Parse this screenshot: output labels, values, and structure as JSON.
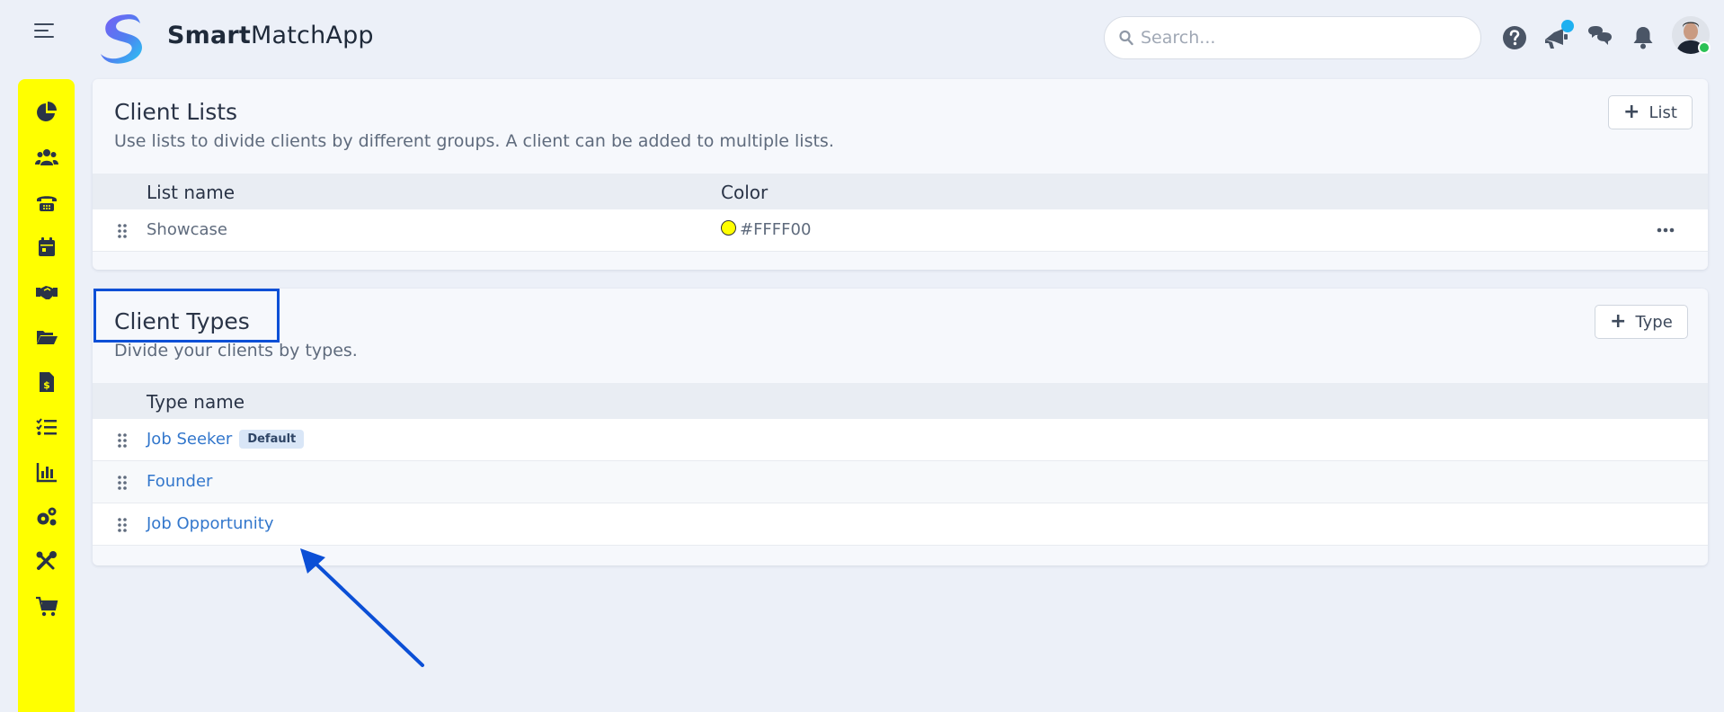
{
  "app": {
    "brand_bold": "Smart",
    "brand_rest": "MatchApp"
  },
  "search": {
    "placeholder": "Search..."
  },
  "header_icons": [
    "help-icon",
    "announcement-icon",
    "chat-icon",
    "notification-bell-icon",
    "user-avatar"
  ],
  "sidebar": {
    "items": [
      "dashboard-icon",
      "clients-icon",
      "calls-icon",
      "calendar-icon",
      "deals-icon",
      "folder-icon",
      "invoice-icon",
      "tasks-icon",
      "reports-icon",
      "settings-icon",
      "tools-icon",
      "cart-icon"
    ],
    "color": "#FFFF00"
  },
  "client_lists": {
    "title": "Client Lists",
    "subtitle": "Use lists to divide clients by different groups. A client can be added to multiple lists.",
    "add_label": "List",
    "columns": [
      "List name",
      "Color"
    ],
    "rows": [
      {
        "name": "Showcase",
        "color": "#FFFF00"
      }
    ]
  },
  "client_types": {
    "title": "Client Types",
    "subtitle": "Divide your clients by types.",
    "add_label": "Type",
    "columns": [
      "Type name"
    ],
    "rows": [
      {
        "name": "Job Seeker",
        "badge": "Default"
      },
      {
        "name": "Founder"
      },
      {
        "name": "Job Opportunity"
      }
    ]
  },
  "annotation_color": "#0B4FD6"
}
